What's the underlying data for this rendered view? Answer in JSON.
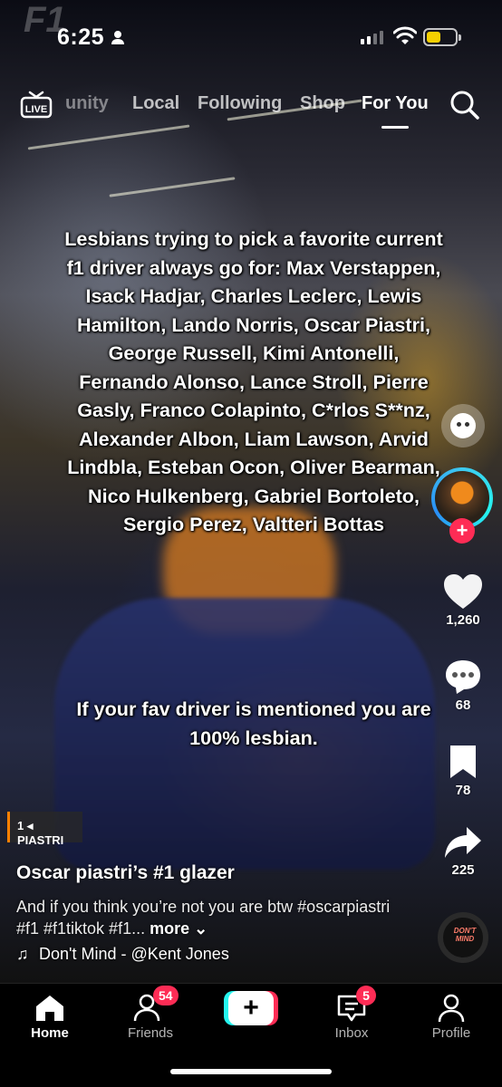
{
  "status_bar": {
    "time": "6:25",
    "battery_color": "#f5d000"
  },
  "top_nav": {
    "live_label": "LIVE",
    "tabs": [
      {
        "label": "unity",
        "state": "faded"
      },
      {
        "label": "Local",
        "state": "inactive"
      },
      {
        "label": "Following",
        "state": "inactive"
      },
      {
        "label": "Shop",
        "state": "inactive"
      },
      {
        "label": "For You",
        "state": "active"
      }
    ],
    "search_icon": "search-icon"
  },
  "video": {
    "overlay_text": "Lesbians trying to pick a favorite current f1 driver always go for: Max Verstappen, Isack Hadjar, Charles Leclerc, Lewis Hamilton, Lando Norris, Oscar Piastri, George Russell, Kimi Antonelli, Fernando Alonso, Lance Stroll, Pierre Gasly, Franco Colapinto, C*rlos S**nz, Alexander Albon, Liam Lawson, Arvid Lindbla, Esteban Ocon, Oliver Bearman, Nico Hulkenberg, Gabriel Bortoleto, Sergio Perez, Valtteri Bottas",
    "overlay_text_2": "If your fav driver is mentioned you are 100% lesbian.",
    "broadcast_tag": "1 ◂ PIASTRI"
  },
  "actions": {
    "likes": "1,260",
    "comments": "68",
    "saves": "78",
    "shares": "225"
  },
  "post": {
    "username": "Oscar piastri’s #1 glazer",
    "description": "And if you think you’re not you are btw #oscarpiastri #f1 #f1tiktok #f1...",
    "more_label": "more",
    "sound": "Don't Mind - @Kent Jones",
    "disc_label": "DON'T MIND"
  },
  "tab_bar": {
    "home": "Home",
    "friends": "Friends",
    "friends_badge": "54",
    "inbox": "Inbox",
    "inbox_badge": "5",
    "profile": "Profile"
  },
  "colors": {
    "accent_pink": "#fe2c55",
    "accent_cyan": "#25f4ee"
  }
}
